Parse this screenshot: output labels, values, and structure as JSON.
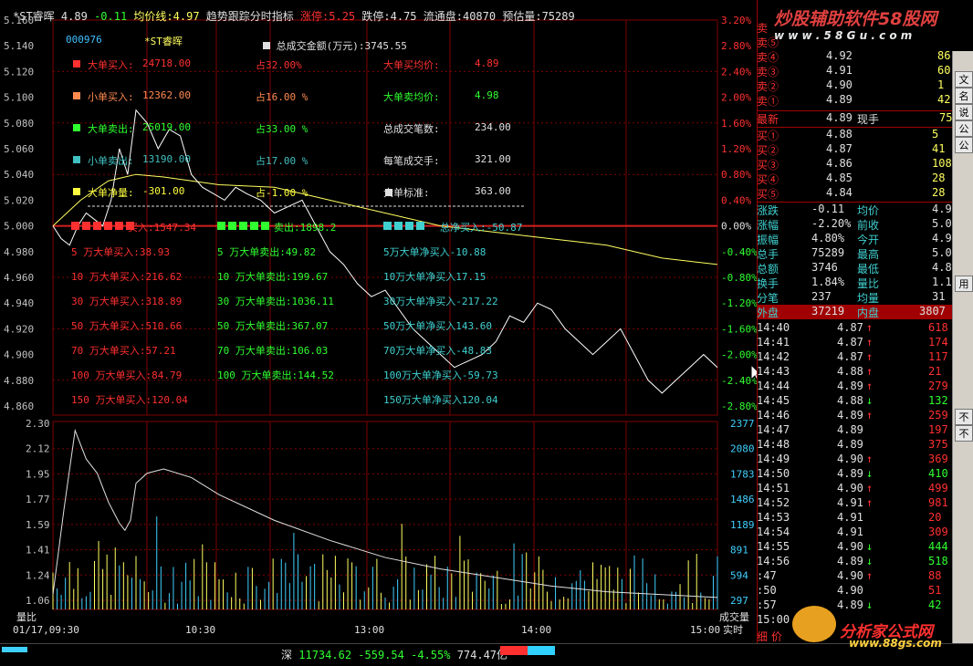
{
  "header": {
    "name": "*ST睿晖",
    "price": "4.89",
    "change": "-0.11",
    "avg_label": "均价线:4.97",
    "indicator": "趋势跟踪分时指标",
    "limit_up": "涨停:5.25",
    "limit_down": "跌停:4.75",
    "float_shares": "流通盘:40870",
    "est_volume": "预估量:75289"
  },
  "stock_code": "000976",
  "stock_name": "*ST睿晖",
  "total_amount": "总成交金额(万元):3745.55",
  "stats": [
    {
      "label": "大单买入:",
      "value": "24718.00",
      "pct": "占32.00%",
      "label2": "大单买均价:",
      "value2": "4.89",
      "color": "#ff3030",
      "color2": "#ff3030"
    },
    {
      "label": "小单买入:",
      "value": "12362.00",
      "pct": "占16.00 %",
      "label2": "大单卖均价:",
      "value2": "4.98",
      "color": "#ff8a50",
      "color2": "#30ff30"
    },
    {
      "label": "大单卖出:",
      "value": "25019.00",
      "pct": "占33.00 %",
      "label2": "总成交笔数:",
      "value2": "234.00",
      "color": "#30ff30",
      "color2": "#e0e0e0"
    },
    {
      "label": "小单卖出:",
      "value": "13190.00",
      "pct": "占17.00 %",
      "label2": "每笔成交手:",
      "value2": "321.00",
      "color": "#40c0c0",
      "color2": "#e0e0e0"
    },
    {
      "label": "大单净量:",
      "value": "-301.00",
      "pct": "占-1.00 %",
      "label2": "大单标准:",
      "value2": "363.00",
      "color": "#ffff40",
      "color2": "#e0e0e0"
    }
  ],
  "big_orders": {
    "buy": [
      "买入:1547.34",
      "5 万大单买入:38.93",
      "10 万大单买入:216.62",
      "30 万大单买入:318.89",
      "50 万大单买入:510.66",
      "70 万大单买入:57.21",
      "100 万大单买入:84.79",
      "150 万大单买入:120.04"
    ],
    "sell": [
      "卖出:1898.2",
      "5 万大单卖出:49.82",
      "10 万大单卖出:199.67",
      "30 万大单卖出:1036.11",
      "50 万大单卖出:367.07",
      "70 万大单卖出:106.03",
      "100 万大单卖出:144.52"
    ],
    "net": [
      "总净买入:-50.87",
      "5万大单净买入-10.88",
      "10万大单净买入17.15",
      "30万大单净买入-217.22",
      "50万大单净买入143.60",
      "70万大单净买入-48.83",
      "100万大单净买入-59.73",
      "150万大单净买入120.04"
    ]
  },
  "chart_data": {
    "type": "line",
    "price_axis": [
      "5.160",
      "5.140",
      "5.120",
      "5.100",
      "5.080",
      "5.060",
      "5.040",
      "5.020",
      "5.000",
      "4.980",
      "4.960",
      "4.940",
      "4.920",
      "4.900",
      "4.880",
      "4.860"
    ],
    "pct_axis": [
      "3.20%",
      "2.80%",
      "2.40%",
      "2.00%",
      "1.60%",
      "1.20%",
      "0.80%",
      "0.40%",
      "0.00%",
      "-0.40%",
      "-0.80%",
      "-1.20%",
      "-1.60%",
      "-2.00%",
      "-2.40%",
      "-2.80%"
    ],
    "vol_ratio_axis": [
      "2.30",
      "2.12",
      "1.95",
      "1.77",
      "1.59",
      "1.41",
      "1.24",
      "1.06"
    ],
    "volume_axis": [
      "2377",
      "2080",
      "1783",
      "1486",
      "1189",
      "891",
      "594",
      "297"
    ],
    "time_ticks": [
      "01/17,09:30",
      "10:30",
      "13:00",
      "14:00",
      "15:00"
    ],
    "vol_ratio_label": "量比",
    "volume_label": "成交量",
    "realtime_label": "实时",
    "ylim": [
      4.86,
      5.16
    ],
    "prev_close": 5.0,
    "series": [
      {
        "x": [
          0,
          3,
          6,
          9,
          12,
          15,
          18,
          21,
          24,
          27,
          30,
          34,
          38,
          42,
          46,
          50,
          54,
          58,
          62,
          66,
          70,
          75,
          80,
          85,
          90,
          95,
          100,
          105,
          110,
          115,
          120,
          125,
          130,
          135,
          140,
          145,
          150,
          155,
          160,
          165,
          170,
          175,
          180,
          185,
          190,
          195,
          200,
          205,
          210,
          215,
          220,
          225,
          230,
          235,
          240
        ],
        "y": [
          5.0,
          4.99,
          4.985,
          5.0,
          5.01,
          5.005,
          5.0,
          5.02,
          5.06,
          5.04,
          5.09,
          5.08,
          5.06,
          5.075,
          5.07,
          5.04,
          5.03,
          5.025,
          5.02,
          5.03,
          5.025,
          5.02,
          5.01,
          5.015,
          5.02,
          5.0,
          4.98,
          4.97,
          4.955,
          4.945,
          4.95,
          4.935,
          4.92,
          4.91,
          4.9,
          4.89,
          4.895,
          4.9,
          4.91,
          4.93,
          4.925,
          4.94,
          4.935,
          4.92,
          4.91,
          4.9,
          4.91,
          4.92,
          4.9,
          4.88,
          4.87,
          4.88,
          4.89,
          4.9,
          4.89
        ]
      },
      {
        "x": [
          0,
          10,
          20,
          30,
          40,
          50,
          60,
          80,
          100,
          120,
          140,
          160,
          180,
          200,
          220,
          240
        ],
        "y": [
          5.0,
          5.02,
          5.035,
          5.04,
          5.038,
          5.035,
          5.032,
          5.03,
          5.02,
          5.01,
          5.0,
          4.995,
          4.99,
          4.985,
          4.975,
          4.97
        ]
      }
    ],
    "vol_ratio_line": {
      "x": [
        0,
        4,
        8,
        12,
        16,
        20,
        24,
        26,
        28,
        30,
        34,
        40,
        50,
        60,
        80,
        100,
        120,
        140,
        160,
        180,
        200,
        220,
        240
      ],
      "y": [
        1.1,
        1.7,
        2.25,
        2.05,
        1.95,
        1.75,
        1.6,
        1.55,
        1.62,
        1.88,
        1.95,
        1.98,
        1.92,
        1.8,
        1.62,
        1.48,
        1.36,
        1.28,
        1.22,
        1.16,
        1.12,
        1.1,
        1.08
      ]
    }
  },
  "quote_panel": {
    "sell_rows": [
      {
        "label": "卖⑤",
        "price": "",
        "vol": ""
      },
      {
        "label": "卖④",
        "price": "4.92",
        "vol": "86"
      },
      {
        "label": "卖③",
        "price": "4.91",
        "vol": "60"
      },
      {
        "label": "卖②",
        "price": "4.90",
        "vol": "1"
      },
      {
        "label": "卖①",
        "price": "4.89",
        "vol": "42"
      }
    ],
    "latest": {
      "label": "最新",
      "price": "4.89",
      "label2": "现手",
      "vol": "75"
    },
    "buy_rows": [
      {
        "label": "买①",
        "price": "4.88",
        "vol": "5"
      },
      {
        "label": "买②",
        "price": "4.87",
        "vol": "41"
      },
      {
        "label": "买③",
        "price": "4.86",
        "vol": "108"
      },
      {
        "label": "买④",
        "price": "4.85",
        "vol": "28"
      },
      {
        "label": "买⑤",
        "price": "4.84",
        "vol": "28"
      }
    ],
    "info_rows": [
      {
        "l1": "涨跌",
        "v1": "-0.11",
        "l2": "均价",
        "v2": "4.9"
      },
      {
        "l1": "涨幅",
        "v1": "-2.20%",
        "l2": "前收",
        "v2": "5.0"
      },
      {
        "l1": "振幅",
        "v1": "4.80%",
        "l2": "今开",
        "v2": "4.9"
      },
      {
        "l1": "总手",
        "v1": "75289",
        "l2": "最高",
        "v2": "5.0"
      },
      {
        "l1": "总额",
        "v1": "3746",
        "l2": "最低",
        "v2": "4.8"
      },
      {
        "l1": "换手",
        "v1": "1.84%",
        "l2": "量比",
        "v2": "1.1"
      },
      {
        "l1": "分笔",
        "v1": "237",
        "l2": "均量",
        "v2": "31"
      }
    ],
    "outer": {
      "l1": "外盘",
      "v1": "37219",
      "l2": "内盘",
      "v2": "3807"
    },
    "ticks": [
      {
        "t": "14:40",
        "p": "4.87",
        "a": "↑",
        "v": "618"
      },
      {
        "t": "14:41",
        "p": "4.87",
        "a": "↑",
        "v": "174"
      },
      {
        "t": "14:42",
        "p": "4.87",
        "a": "↑",
        "v": "117"
      },
      {
        "t": "14:43",
        "p": "4.88",
        "a": "↑",
        "v": "21"
      },
      {
        "t": "14:44",
        "p": "4.89",
        "a": "↑",
        "v": "279"
      },
      {
        "t": "14:45",
        "p": "4.88",
        "a": "↓",
        "v": "132"
      },
      {
        "t": "14:46",
        "p": "4.89",
        "a": "↑",
        "v": "259"
      },
      {
        "t": "14:47",
        "p": "4.89",
        "a": "",
        "v": "197"
      },
      {
        "t": "14:48",
        "p": "4.89",
        "a": "",
        "v": "375"
      },
      {
        "t": "14:49",
        "p": "4.90",
        "a": "↑",
        "v": "369"
      },
      {
        "t": "14:50",
        "p": "4.89",
        "a": "↓",
        "v": "410"
      },
      {
        "t": "14:51",
        "p": "4.90",
        "a": "↑",
        "v": "499"
      },
      {
        "t": "14:52",
        "p": "4.91",
        "a": "↑",
        "v": "981"
      },
      {
        "t": "14:53",
        "p": "4.91",
        "a": "",
        "v": "20"
      },
      {
        "t": "14:54",
        "p": "4.91",
        "a": "",
        "v": "309"
      },
      {
        "t": "14:55",
        "p": "4.90",
        "a": "↓",
        "v": "444"
      },
      {
        "t": "14:56",
        "p": "4.89",
        "a": "↓",
        "v": "518"
      },
      {
        "t": ":47",
        "p": "4.90",
        "a": "↑",
        "v": "88"
      },
      {
        "t": ":50",
        "p": "4.90",
        "a": "",
        "v": "51"
      },
      {
        "t": ":57",
        "p": "4.89",
        "a": "↓",
        "v": "42"
      },
      {
        "t": "15:00",
        "p": "",
        "a": "",
        "v": ""
      }
    ],
    "side_tab": "卖",
    "bottom_tabs": [
      "细",
      "价"
    ]
  },
  "scroll_buttons": [
    "文",
    "名",
    "说",
    "公",
    "公",
    "不",
    "不",
    "用"
  ],
  "statusbar": {
    "market": "深",
    "index": "11734.62",
    "change": "-559.54",
    "pct": "-4.55%",
    "amount": "774.47亿"
  },
  "watermarks": {
    "top": "炒股辅助软件58股网",
    "top_url": "w w w . 5 8 G u . c o m",
    "bottom": "分析家公式网",
    "bottom_url": "www.88gs.com"
  },
  "colors": {
    "up": "#ff3030",
    "down": "#30ff30",
    "grid": "#800000",
    "price_line": "#ffffff",
    "avg_line": "#ffff60",
    "neutral": "#e0e0e0"
  }
}
